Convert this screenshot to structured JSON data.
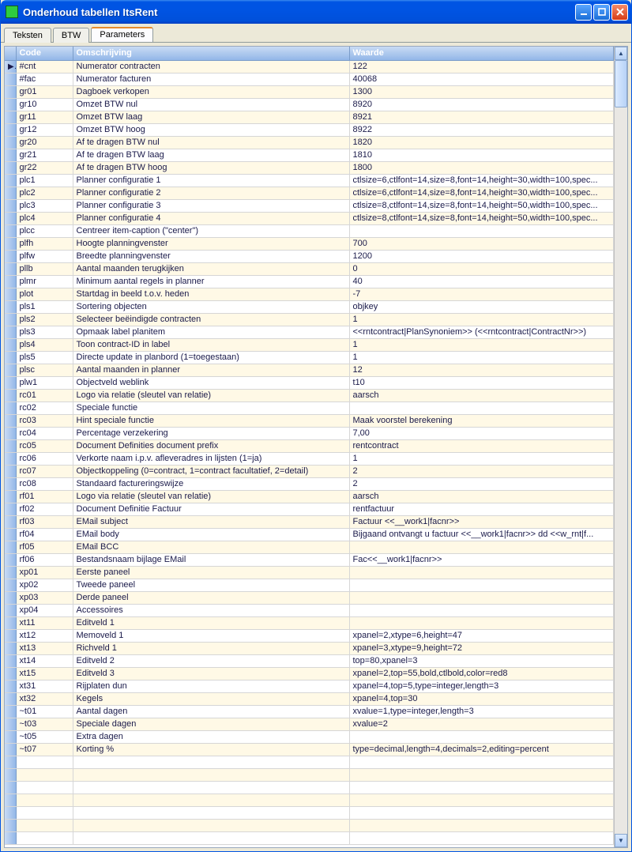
{
  "window": {
    "title": "Onderhoud tabellen ItsRent"
  },
  "tabs": [
    {
      "label": "Teksten",
      "active": false
    },
    {
      "label": "BTW",
      "active": false
    },
    {
      "label": "Parameters",
      "active": true
    }
  ],
  "columns": {
    "code": "Code",
    "desc": "Omschrijving",
    "value": "Waarde"
  },
  "rows": [
    {
      "code": "#cnt",
      "desc": "Numerator contracten",
      "value": "122",
      "current": true
    },
    {
      "code": "#fac",
      "desc": "Numerator facturen",
      "value": "40068"
    },
    {
      "code": "gr01",
      "desc": "Dagboek verkopen",
      "value": "1300"
    },
    {
      "code": "gr10",
      "desc": "Omzet BTW nul",
      "value": "8920"
    },
    {
      "code": "gr11",
      "desc": "Omzet BTW laag",
      "value": "8921"
    },
    {
      "code": "gr12",
      "desc": "Omzet BTW hoog",
      "value": "8922"
    },
    {
      "code": "gr20",
      "desc": "Af te dragen BTW nul",
      "value": "1820"
    },
    {
      "code": "gr21",
      "desc": "Af te dragen BTW laag",
      "value": "1810"
    },
    {
      "code": "gr22",
      "desc": "Af te dragen BTW hoog",
      "value": "1800"
    },
    {
      "code": "plc1",
      "desc": "Planner configuratie 1",
      "value": "ctlsize=6,ctlfont=14,size=8,font=14,height=30,width=100,spec..."
    },
    {
      "code": "plc2",
      "desc": "Planner configuratie 2",
      "value": "ctlsize=6,ctlfont=14,size=8,font=14,height=30,width=100,spec..."
    },
    {
      "code": "plc3",
      "desc": "Planner configuratie 3",
      "value": "ctlsize=8,ctlfont=14,size=8,font=14,height=50,width=100,spec..."
    },
    {
      "code": "plc4",
      "desc": "Planner configuratie 4",
      "value": "ctlsize=8,ctlfont=14,size=8,font=14,height=50,width=100,spec..."
    },
    {
      "code": "plcc",
      "desc": "Centreer item-caption (\"center\")",
      "value": ""
    },
    {
      "code": "plfh",
      "desc": "Hoogte planningvenster",
      "value": "700"
    },
    {
      "code": "plfw",
      "desc": "Breedte planningvenster",
      "value": "1200"
    },
    {
      "code": "pllb",
      "desc": "Aantal maanden terugkijken",
      "value": "0"
    },
    {
      "code": "plmr",
      "desc": "Minimum aantal regels in planner",
      "value": "40"
    },
    {
      "code": "plot",
      "desc": "Startdag in beeld t.o.v. heden",
      "value": "-7"
    },
    {
      "code": "pls1",
      "desc": "Sortering objecten",
      "value": "objkey"
    },
    {
      "code": "pls2",
      "desc": "Selecteer beëindigde contracten",
      "value": "1"
    },
    {
      "code": "pls3",
      "desc": "Opmaak label planitem",
      "value": "<<rntcontract|PlanSynoniem>> (<<rntcontract|ContractNr>>)"
    },
    {
      "code": "pls4",
      "desc": "Toon contract-ID in label",
      "value": "1"
    },
    {
      "code": "pls5",
      "desc": "Directe update in planbord (1=toegestaan)",
      "value": "1"
    },
    {
      "code": "plsc",
      "desc": "Aantal maanden in planner",
      "value": "12"
    },
    {
      "code": "plw1",
      "desc": "Objectveld weblink",
      "value": "t10"
    },
    {
      "code": "rc01",
      "desc": "Logo via relatie (sleutel van relatie)",
      "value": "aarsch"
    },
    {
      "code": "rc02",
      "desc": "Speciale functie",
      "value": ""
    },
    {
      "code": "rc03",
      "desc": "Hint speciale functie",
      "value": "Maak voorstel berekening"
    },
    {
      "code": "rc04",
      "desc": "Percentage verzekering",
      "value": "7,00"
    },
    {
      "code": "rc05",
      "desc": "Document Definities document prefix",
      "value": "rentcontract"
    },
    {
      "code": "rc06",
      "desc": "Verkorte naam i.p.v. afleveradres in lijsten (1=ja)",
      "value": "1"
    },
    {
      "code": "rc07",
      "desc": "Objectkoppeling (0=contract, 1=contract facultatief, 2=detail)",
      "value": "2"
    },
    {
      "code": "rc08",
      "desc": "Standaard factureringswijze",
      "value": "2"
    },
    {
      "code": "rf01",
      "desc": "Logo via relatie (sleutel van relatie)",
      "value": "aarsch"
    },
    {
      "code": "rf02",
      "desc": "Document Definitie Factuur",
      "value": "rentfactuur"
    },
    {
      "code": "rf03",
      "desc": "EMail subject",
      "value": "Factuur <<__work1|facnr>>"
    },
    {
      "code": "rf04",
      "desc": "EMail body",
      "value": "Bijgaand ontvangt u factuur <<__work1|facnr>> dd <<w_rnt|f..."
    },
    {
      "code": "rf05",
      "desc": "EMail BCC",
      "value": ""
    },
    {
      "code": "rf06",
      "desc": "Bestandsnaam bijlage EMail",
      "value": "Fac<<__work1|facnr>>"
    },
    {
      "code": "xp01",
      "desc": "Eerste paneel",
      "value": ""
    },
    {
      "code": "xp02",
      "desc": "Tweede paneel",
      "value": ""
    },
    {
      "code": "xp03",
      "desc": "Derde paneel",
      "value": ""
    },
    {
      "code": "xp04",
      "desc": "Accessoires",
      "value": ""
    },
    {
      "code": "xt11",
      "desc": "Editveld 1",
      "value": ""
    },
    {
      "code": "xt12",
      "desc": "Memoveld 1",
      "value": "xpanel=2,xtype=6,height=47"
    },
    {
      "code": "xt13",
      "desc": "Richveld 1",
      "value": "xpanel=3,xtype=9,height=72"
    },
    {
      "code": "xt14",
      "desc": "Editveld 2",
      "value": "top=80,xpanel=3"
    },
    {
      "code": "xt15",
      "desc": "Editveld 3",
      "value": "xpanel=2,top=55,bold,ctlbold,color=red8"
    },
    {
      "code": "xt31",
      "desc": "Rijplaten dun",
      "value": "xpanel=4,top=5,type=integer,length=3"
    },
    {
      "code": "xt32",
      "desc": "Kegels",
      "value": "xpanel=4,top=30"
    },
    {
      "code": "~t01",
      "desc": "Aantal dagen",
      "value": "xvalue=1,type=integer,length=3"
    },
    {
      "code": "~t03",
      "desc": "Speciale dagen",
      "value": "xvalue=2"
    },
    {
      "code": "~t05",
      "desc": "Extra dagen",
      "value": ""
    },
    {
      "code": "~t07",
      "desc": "Korting %",
      "value": "type=decimal,length=4,decimals=2,editing=percent"
    }
  ],
  "empty_rows": 7
}
